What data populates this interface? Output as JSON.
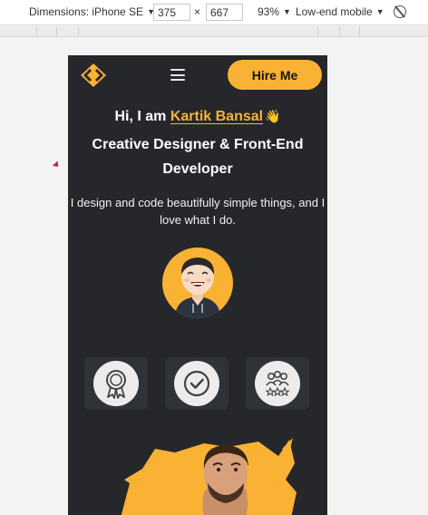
{
  "devtools": {
    "dimensions_label": "Dimensions: iPhone SE",
    "width_value": "375",
    "times": "×",
    "height_value": "667",
    "zoom": "93%",
    "throttle": "Low-end mobile",
    "rotate_icon": "rotate-icon"
  },
  "site": {
    "logo_icon": "code-brackets-logo",
    "menu_icon": "hamburger-icon",
    "hire_label": "Hire Me",
    "greeting_prefix": "Hi, I am ",
    "name": "Kartik Bansal",
    "wave": "👋",
    "role_line1": "Creative Designer & Front-End",
    "role_line2": "Developer",
    "description": "I design and code beautifully simple things, and I love what I do.",
    "badges": [
      {
        "icon": "award-ribbon-icon"
      },
      {
        "icon": "check-circle-icon"
      },
      {
        "icon": "team-star-icon"
      }
    ]
  },
  "colors": {
    "accent": "#f9b234",
    "background": "#25272b",
    "card": "#2f3237"
  }
}
